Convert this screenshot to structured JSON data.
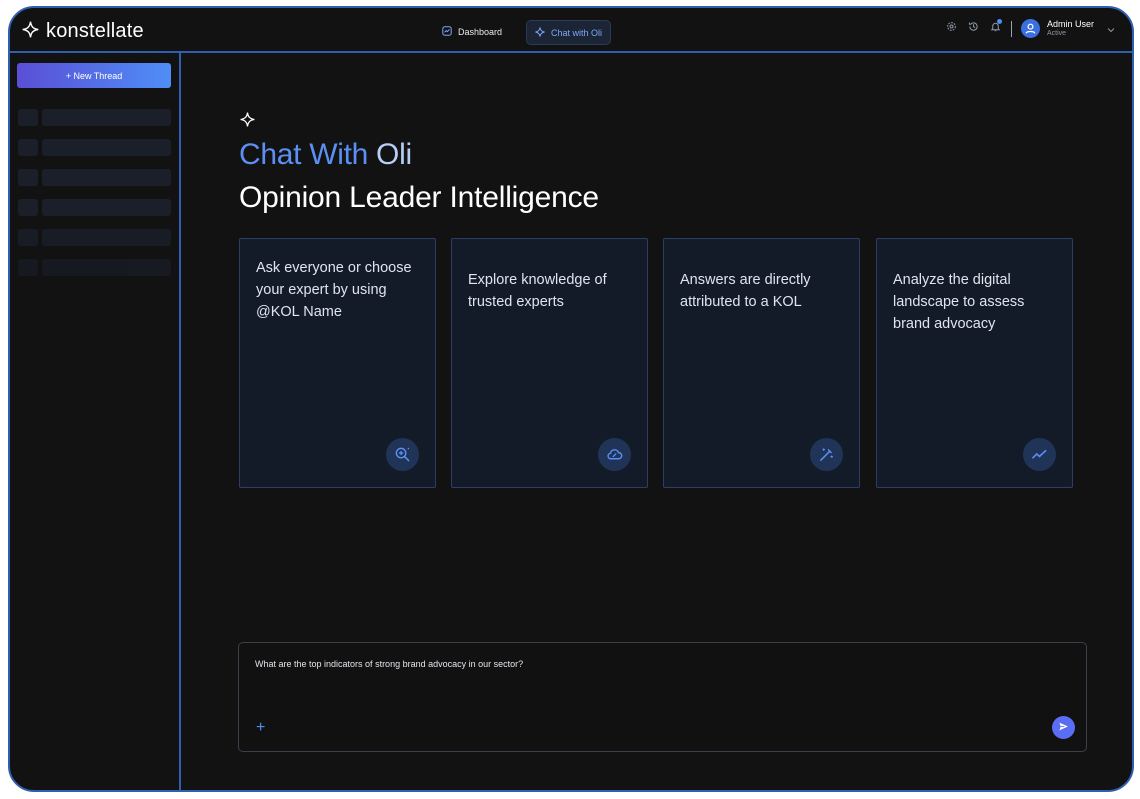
{
  "app": {
    "brand": "konstellate"
  },
  "nav": {
    "dashboard_label": "Dashboard",
    "chat_label": "Chat with Oli"
  },
  "header_icons": [
    "gear-icon",
    "history-icon",
    "bell-icon"
  ],
  "user": {
    "name": "Admin User",
    "status": "Active"
  },
  "sidebar": {
    "new_thread_label": "+ New Thread",
    "skeleton_rows": 6
  },
  "hero": {
    "title_part1": "Chat With ",
    "title_part2": "Oli",
    "subtitle": "Opinion Leader Intelligence"
  },
  "cards": [
    {
      "text": "Ask everyone or choose your expert by using @KOL Name",
      "icon": "search-plus-icon"
    },
    {
      "text": "Explore knowledge of trusted experts",
      "icon": "cloud-link-icon"
    },
    {
      "text": "Answers are directly attributed to a KOL",
      "icon": "magic-wand-icon"
    },
    {
      "text": "Analyze the digital landscape to assess brand advocacy",
      "icon": "trend-line-icon"
    }
  ],
  "prompt": {
    "value": "What are the top indicators of strong brand advocacy in our sector?",
    "add_label": "+"
  },
  "colors": {
    "accent": "#4f8ef7",
    "frame_border": "#2f5fae",
    "background": "#121212",
    "card_background": "#141b28"
  }
}
